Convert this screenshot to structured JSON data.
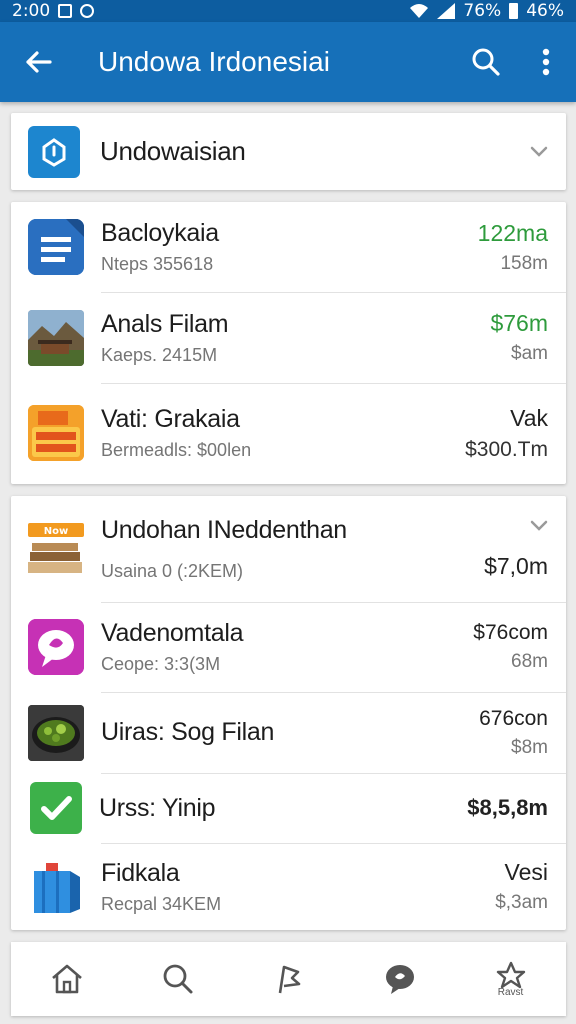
{
  "status_bar": {
    "time": "2:00",
    "wifi_level": "76%",
    "battery": "46%"
  },
  "header": {
    "title": "Undowa Irdonesiai"
  },
  "group_header": {
    "title": "Undowaisian"
  },
  "list_one": [
    {
      "name": "Bacloykaia",
      "sub": "Nteps 355618",
      "value": "122ma",
      "value_sub": "158m",
      "value_color": "#2e9b3c",
      "icon": "document-icon"
    },
    {
      "name": "Anals Filam",
      "sub": "Kaeps. 2415M",
      "value": "$76m",
      "value_sub": "$am",
      "value_color": "#2e9b3c",
      "icon": "landscape-photo-icon"
    },
    {
      "name": "Vati: Grakaia",
      "sub": "Bermeadls: $00len",
      "value": "Vak",
      "value_sub": "$300.Tm",
      "value_color": "#222222",
      "icon": "game-box-icon"
    }
  ],
  "list_two_header": {
    "name": "Undohan INeddenthan",
    "sub": "Usaina 0 (:2KEM)",
    "value": "$7,0m",
    "badge": "Now"
  },
  "list_two": [
    {
      "name": "Vadenomtala",
      "sub": "Ceope: 3:3(3M",
      "value": "$76com",
      "value_sub": "68m",
      "icon": "chat-bubble-icon"
    },
    {
      "name": "Uiras: Sog Filan",
      "sub": "",
      "value": "676con",
      "value_sub": "$8m",
      "icon": "food-bowl-icon"
    },
    {
      "name": "Urss: Yinip",
      "sub": "",
      "value": "$8,5,8m",
      "value_sub": "",
      "icon": "checkmark-icon"
    },
    {
      "name": "Fidkala",
      "sub": "Recpal 34KEM",
      "value": "Vesi",
      "value_sub": "$,3am",
      "icon": "shopping-bag-icon"
    }
  ],
  "bottom_nav": [
    {
      "icon": "home-icon",
      "label": ""
    },
    {
      "icon": "search-icon",
      "label": ""
    },
    {
      "icon": "flag-icon",
      "label": ""
    },
    {
      "icon": "chat-icon",
      "label": ""
    },
    {
      "icon": "star-icon",
      "label": "Ravst"
    }
  ],
  "colors": {
    "primary": "#1670b9",
    "status_bar": "#0d5da0",
    "accent_green": "#2e9b3c"
  }
}
